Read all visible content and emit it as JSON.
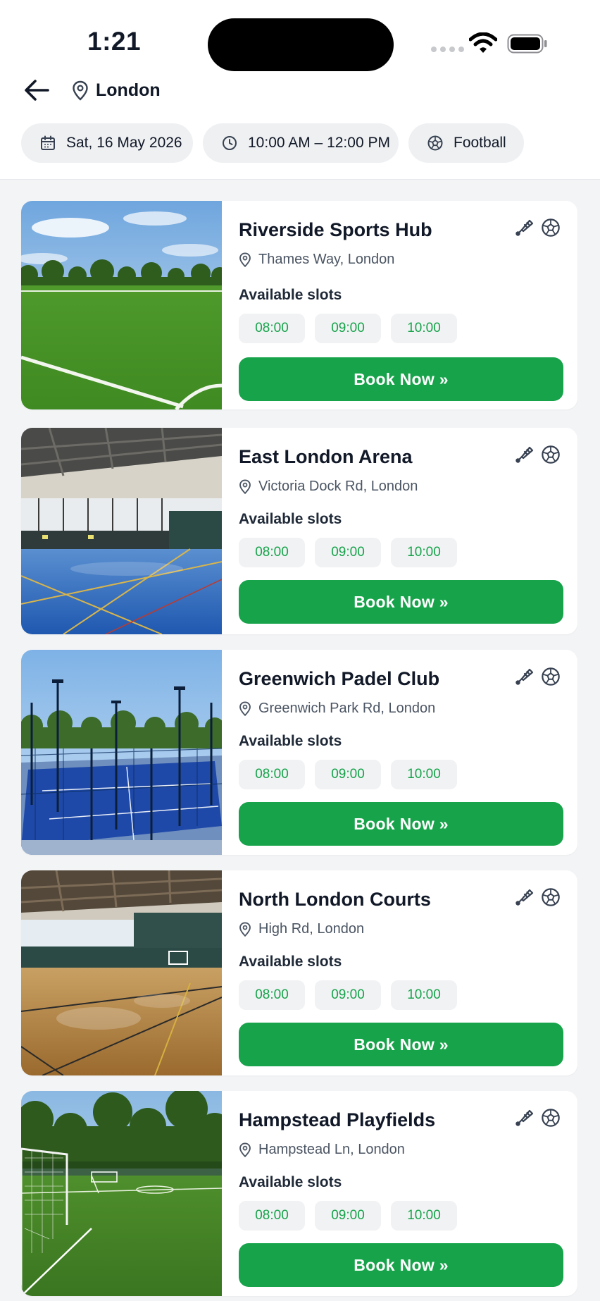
{
  "status_bar": {
    "time": "1:21"
  },
  "header": {
    "location": "London"
  },
  "filters": {
    "date": "Sat, 16 May 2026",
    "time_range": "10:00 AM – 12:00 PM",
    "sport": "Football"
  },
  "venues": [
    {
      "name": "Riverside Sports Hub",
      "address": "Thames Way, London",
      "slots_label": "Available slots",
      "slots": [
        "08:00",
        "09:00",
        "10:00"
      ],
      "cta": "Book Now »"
    },
    {
      "name": "East London Arena",
      "address": "Victoria Dock Rd, London",
      "slots_label": "Available slots",
      "slots": [
        "08:00",
        "09:00",
        "10:00"
      ],
      "cta": "Book Now »"
    },
    {
      "name": "Greenwich Padel Club",
      "address": "Greenwich Park Rd, London",
      "slots_label": "Available slots",
      "slots": [
        "08:00",
        "09:00",
        "10:00"
      ],
      "cta": "Book Now »"
    },
    {
      "name": "North London Courts",
      "address": "High Rd, London",
      "slots_label": "Available slots",
      "slots": [
        "08:00",
        "09:00",
        "10:00"
      ],
      "cta": "Book Now »"
    },
    {
      "name": "Hampstead Playfields",
      "address": "Hampstead Ln, London",
      "slots_label": "Available slots",
      "slots": [
        "08:00",
        "09:00",
        "10:00"
      ],
      "cta": "Book Now »"
    }
  ],
  "icons": {
    "back": "arrow-left-icon",
    "location": "map-pin-icon",
    "date": "calendar-icon",
    "time": "clock-icon",
    "sport": "soccer-ball-icon",
    "venue_sports": [
      "shuttlecock-icon",
      "soccer-ball-icon"
    ]
  },
  "colors": {
    "accent": "#16a34a",
    "page_bg": "#f3f4f6",
    "chip_bg": "#eef0f2",
    "text": "#111827",
    "muted": "#4b5563"
  }
}
